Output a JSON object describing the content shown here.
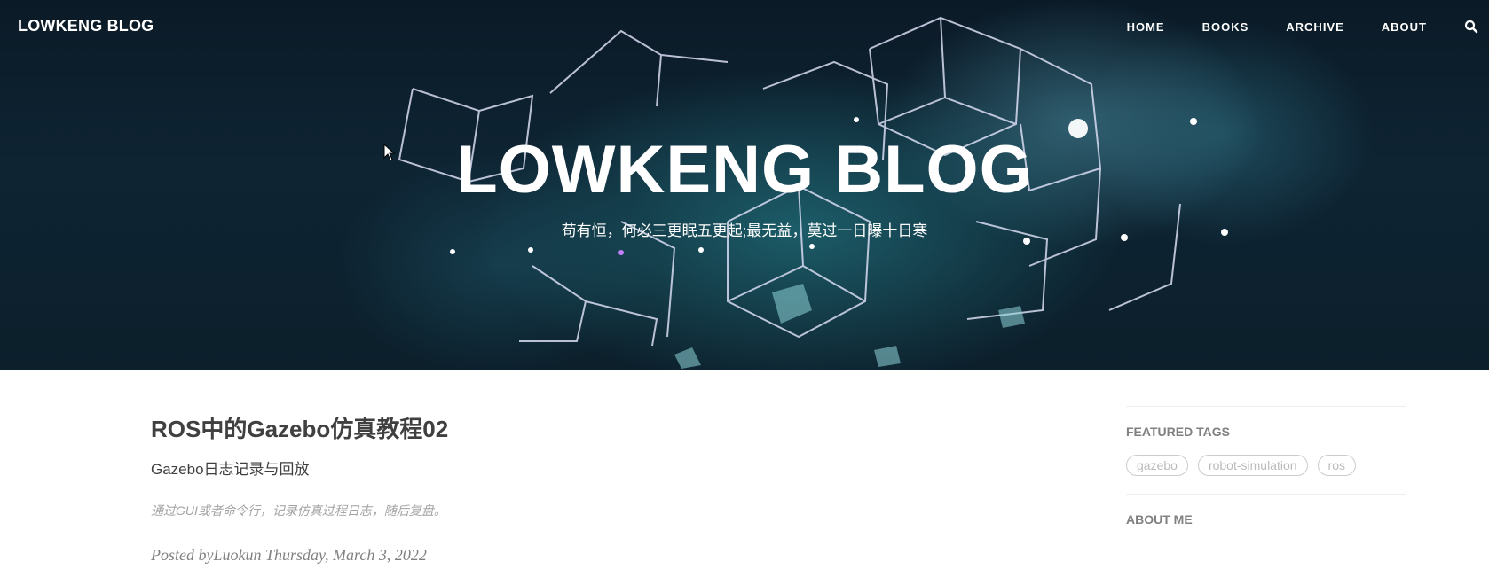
{
  "navbar": {
    "brand": "LOWKENG BLOG",
    "items": [
      {
        "label": "HOME"
      },
      {
        "label": "BOOKS"
      },
      {
        "label": "ARCHIVE"
      },
      {
        "label": "ABOUT"
      }
    ],
    "search_icon": "search-icon"
  },
  "hero": {
    "title": "LOWKENG BLOG",
    "subtitle": "苟有恒，何必三更眠五更起;最无益，莫过一日曝十日寒"
  },
  "post": {
    "title": "ROS中的Gazebo仿真教程02",
    "subtitle": "Gazebo日志记录与回放",
    "excerpt": "通过GUI或者命令行，记录仿真过程日志，随后复盘。",
    "meta": "Posted byLuokun Thursday, March 3, 2022"
  },
  "sidebar": {
    "featured_tags_heading": "FEATURED TAGS",
    "tags": [
      "gazebo",
      "robot-simulation",
      "ros"
    ],
    "about_heading": "ABOUT ME"
  },
  "colors": {
    "hero_bg": "#0c1f2b",
    "text": "#404040",
    "meta": "#808080",
    "tag_border": "#cccccc"
  }
}
